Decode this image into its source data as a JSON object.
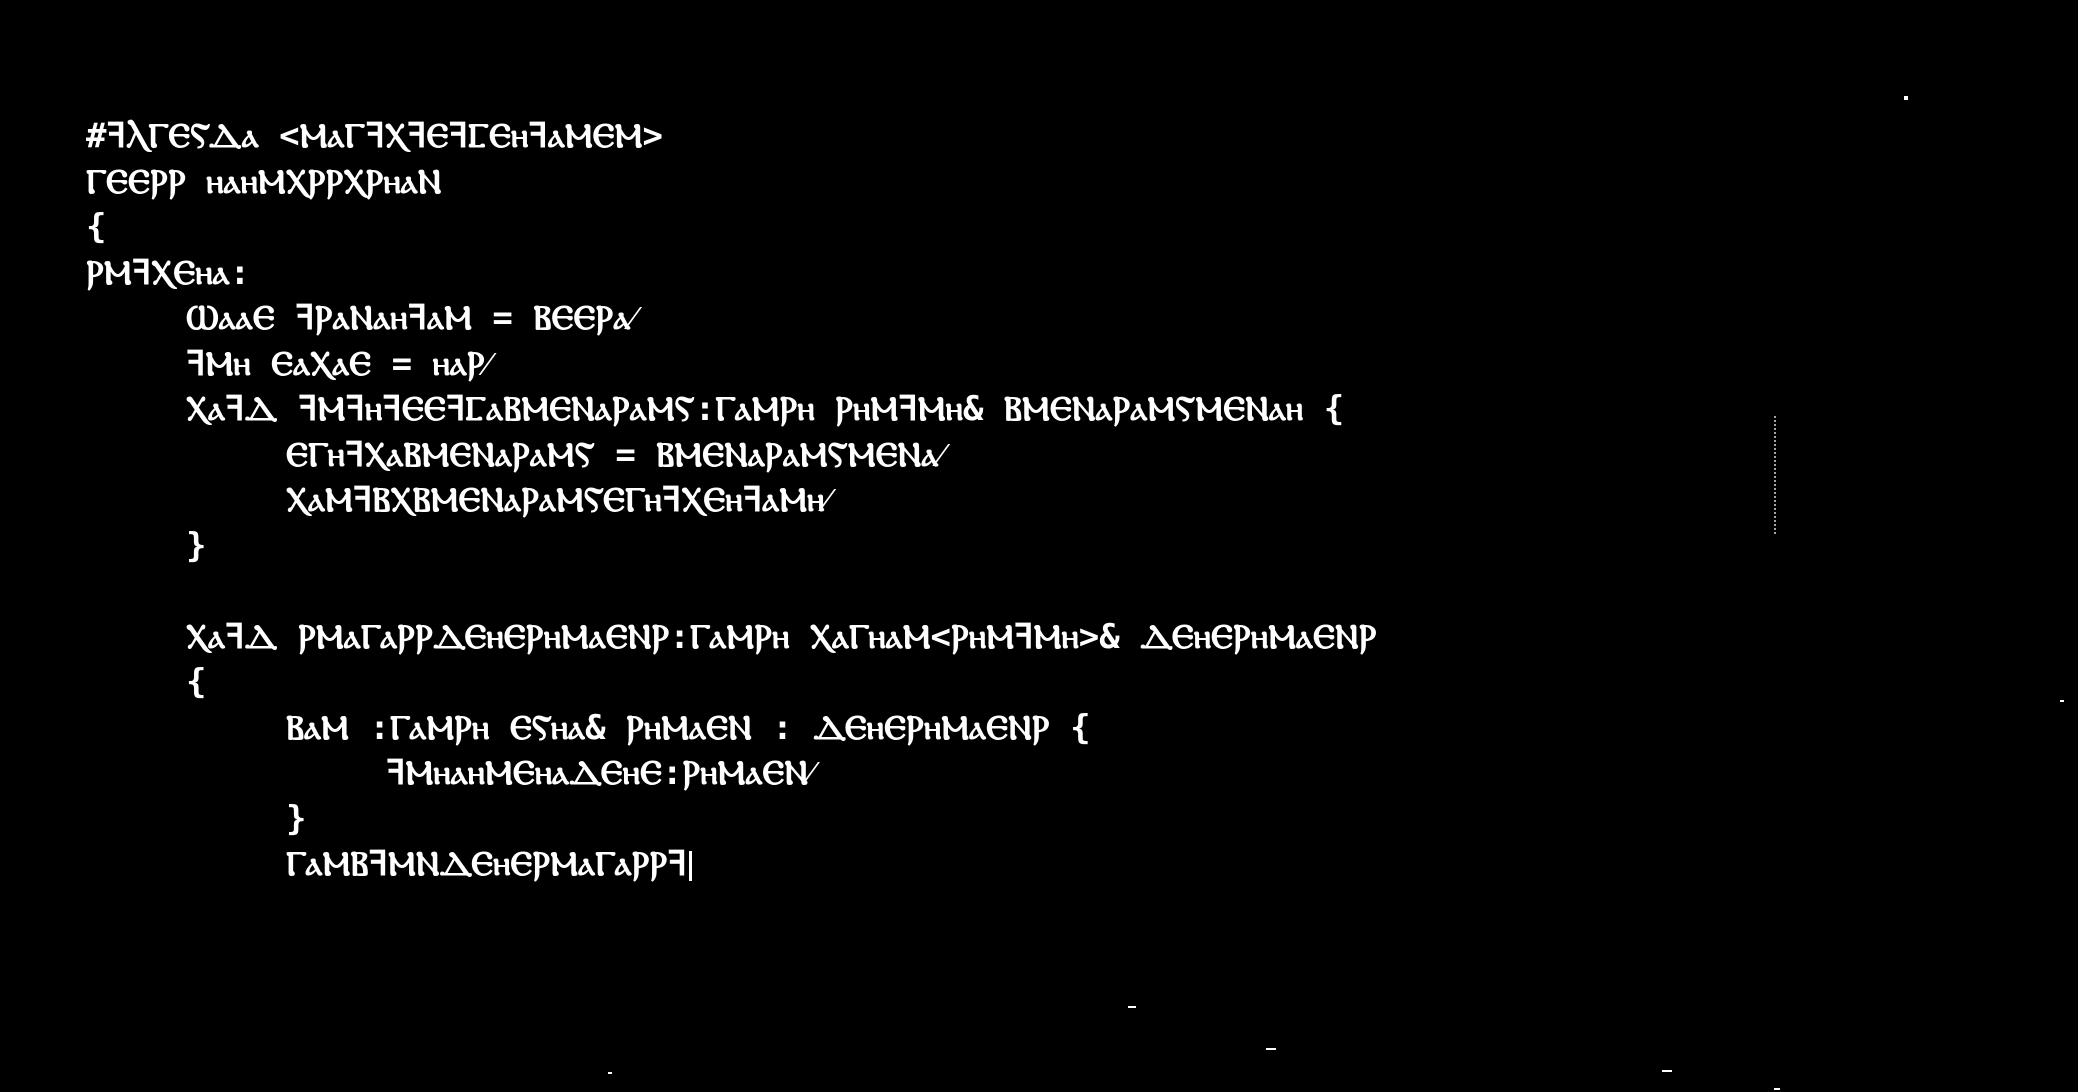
{
  "editor": {
    "lines": [
      {
        "indent": 0,
        "text": "#ꟻⲖⲄⲈⲊⲆⲁ <ⲘⲁⲄꟻⲬꟻⲈꟻⳞⲈⲏꟻⲁⲘⲈⲘ>"
      },
      {
        "indent": 0,
        "text": "ⲄⲈⲈⲢⲢ ⲏⲁⲏⲘⲬⲢⲢⲬⲢⲏⲁⲚ"
      },
      {
        "indent": 0,
        "text": "{"
      },
      {
        "indent": 0,
        "text": "ⲢⲘꟻⲬⲈⲏⲁ:"
      },
      {
        "indent": 1,
        "text": "ⲰⲁⲁⲈ ꟻⲢⲁⲚⲁⲏꟻⲁⲘ = ⲂⲈⲈⲢⲁ⁄"
      },
      {
        "indent": 1,
        "text": "ꟻⲘⲏ ⲈⲁⲬⲁⲈ = ⲏⲁⲢ⁄"
      },
      {
        "indent": 1,
        "text": "ⲬⲁꟻⲆ ꟻⲘꟻⲏꟻⲈⲈꟻⳞⲁⲂⲘⲈⲚⲁⲢⲁⲘⲊ:ⲄⲁⲘⲢⲏ ⲢⲏⲘꟻⲘⲏ& ⲂⲘⲈⲚⲁⲢⲁⲘⲊⲘⲈⲚⲁⲏ {"
      },
      {
        "indent": 2,
        "text": "ⲈⲄⲏꟻⲬⲁⲂⲘⲈⲚⲁⲢⲁⲘⲊ = ⲂⲘⲈⲚⲁⲢⲁⲘⲊⲘⲈⲚⲁ⁄"
      },
      {
        "indent": 2,
        "text": "ⲬⲁⲘꟻⲂⲬⲂⲘⲈⲚⲁⲢⲁⲘⲊⲈⲄⲏꟻⲬⲈⲏꟻⲁⲘⲏ⁄"
      },
      {
        "indent": 1,
        "text": "}"
      },
      {
        "indent": 0,
        "text": ""
      },
      {
        "indent": 1,
        "text": "ⲬⲁꟻⲆ ⲢⲘⲁⲄⲁⲢⲢⲆⲈⲏⲈⲢⲏⲘⲁⲈⲚⲢ:ⲄⲁⲘⲢⲏ ⲬⲁⲄⲏⲁⲘ<ⲢⲏⲘꟻⲘⲏ>& ⲆⲈⲏⲈⲢⲏⲘⲁⲈⲚⲢ"
      },
      {
        "indent": 1,
        "text": "{"
      },
      {
        "indent": 2,
        "text": "ⲂⲁⲘ :ⲄⲁⲘⲢⲏ ⲈⲊⲏⲁ& ⲢⲏⲘⲁⲈⲚ : ⲆⲈⲏⲈⲢⲏⲘⲁⲈⲚⲢ {"
      },
      {
        "indent": 3,
        "text": "ꟻⲘⲏⲁⲏⲘⲈⲏⲁⲆⲈⲏⲈ:ⲢⲏⲘⲁⲈⲚ⁄"
      },
      {
        "indent": 2,
        "text": "}"
      },
      {
        "indent": 2,
        "text": "ⲄⲁⲘⲂꟻⲘⲚⲆⲈⲏⲈⲢⲘⲁⲄⲁⲢⲢꟻ"
      }
    ]
  },
  "colors": {
    "background": "#000000",
    "text": "#ffffff"
  }
}
